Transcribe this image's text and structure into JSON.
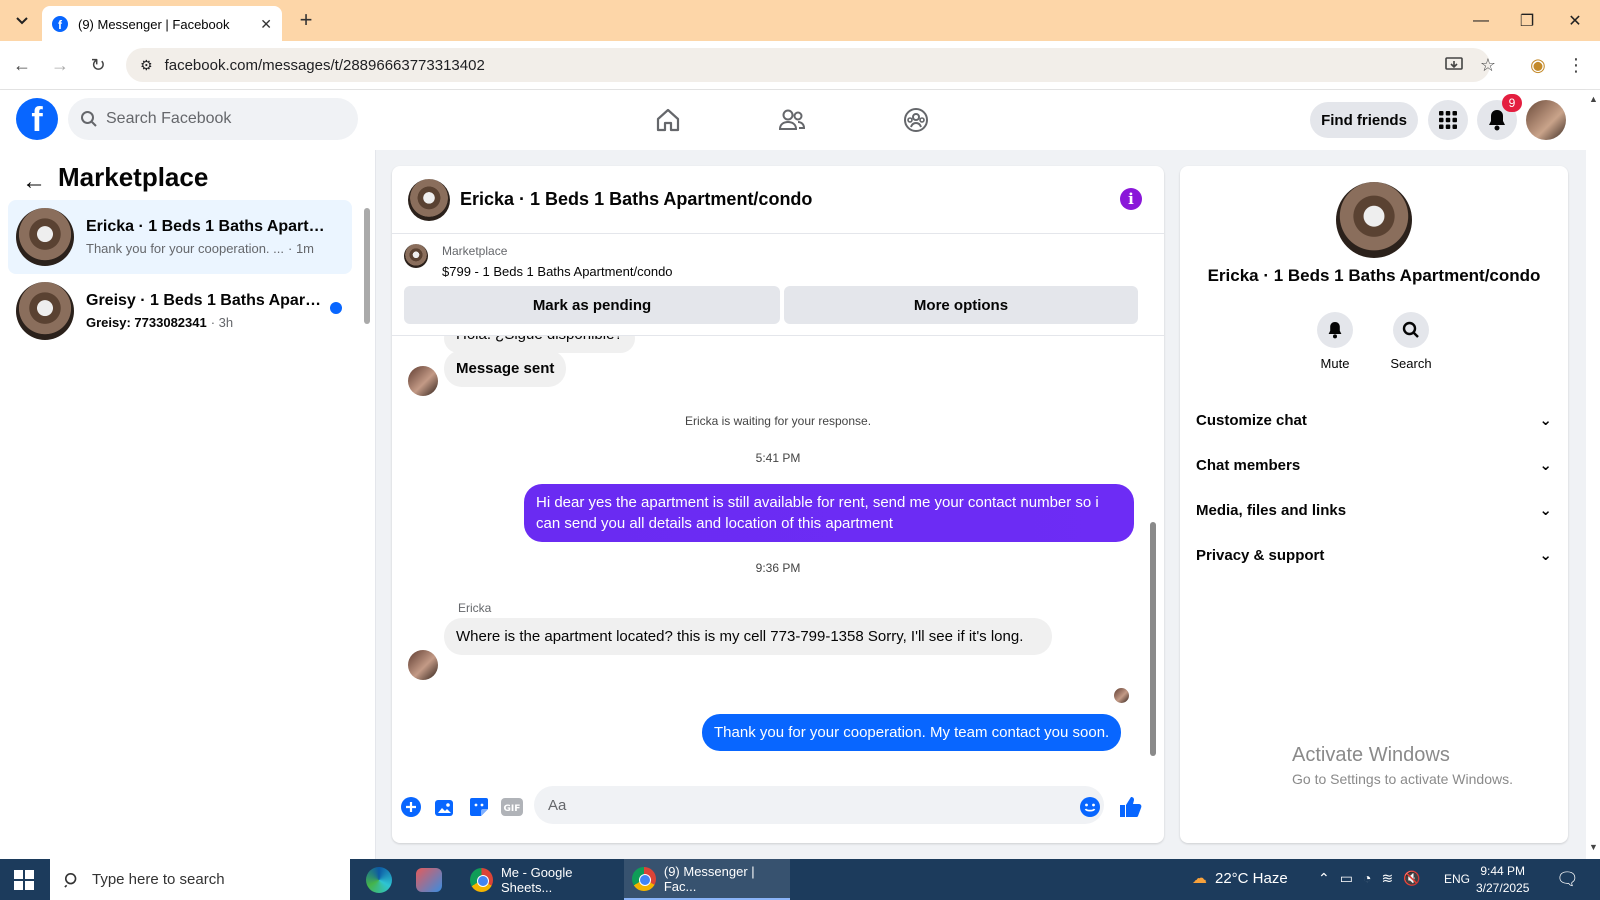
{
  "browser": {
    "tab_title": "(9) Messenger | Facebook",
    "url": "facebook.com/messages/t/28896663773313402"
  },
  "fb": {
    "search_placeholder": "Search Facebook",
    "find_friends": "Find friends",
    "notifications_count": "9"
  },
  "left_panel": {
    "title": "Marketplace",
    "conversations": [
      {
        "name": "Ericka · 1 Beds 1 Baths Apartmen...",
        "preview": "Thank you for your cooperation. ...",
        "time": "· 1m"
      },
      {
        "name": "Greisy · 1 Beds 1 Baths Apartm...",
        "preview": "Greisy: 7733082341",
        "time": "· 3h"
      }
    ]
  },
  "chat": {
    "title": "Ericka · 1 Beds 1 Baths Apartment/condo",
    "listing_category": "Marketplace",
    "listing_title": "$799 - 1 Beds 1 Baths Apartment/condo",
    "mark_pending": "Mark as pending",
    "more_options": "More options",
    "messages": {
      "partial": "Hola. ¿Sigue disponible?",
      "msg_sent": "Message sent",
      "waiting": "Ericka is waiting for your response.",
      "time1": "5:41 PM",
      "out1": "Hi dear yes the apartment is still available for rent, send me your contact number so i can send you all details and location of this apartment",
      "time2": "9:36 PM",
      "sender": "Ericka",
      "in2": "Where is the apartment located? this is my cell 773-799-1358 Sorry, I'll see if it's long.",
      "out2": "Thank you for your cooperation. My team contact you soon."
    },
    "input_placeholder": "Aa"
  },
  "right_panel": {
    "name": "Ericka · 1 Beds 1 Baths Apartment/condo",
    "mute": "Mute",
    "search": "Search",
    "sections": [
      "Customize chat",
      "Chat members",
      "Media, files and links",
      "Privacy & support"
    ]
  },
  "watermark": {
    "line1": "Activate Windows",
    "line2": "Go to Settings to activate Windows."
  },
  "taskbar": {
    "search_placeholder": "Type here to search",
    "app1": "Me - Google Sheets...",
    "app2": "(9) Messenger | Fac...",
    "weather": "22°C  Haze",
    "lang": "ENG",
    "time": "9:44 PM",
    "date": "3/27/2025"
  },
  "colors": {
    "fb_blue": "#0866ff",
    "outgoing_purple": "#6a2bf2",
    "info_purple": "#8a17d9",
    "tabbar": "#fdd6a8"
  }
}
